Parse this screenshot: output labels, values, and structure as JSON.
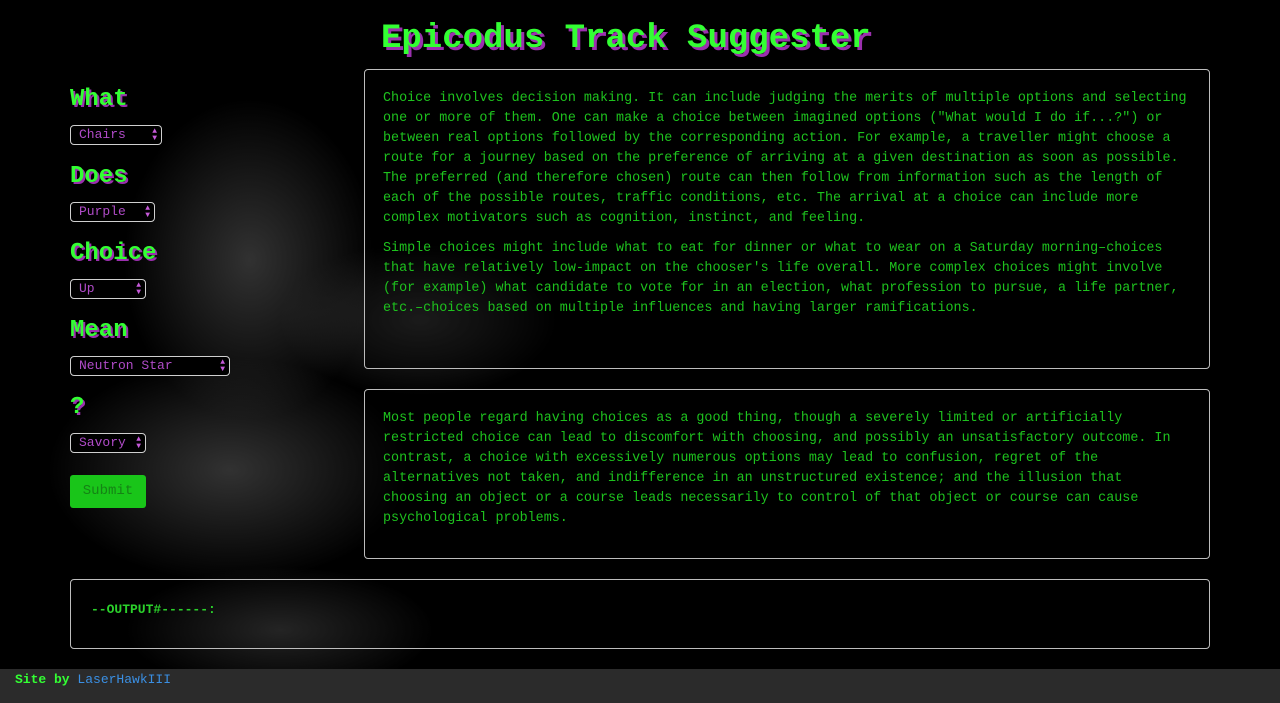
{
  "title": "Epicodus Track Suggester",
  "form": {
    "questions": [
      {
        "label": "What",
        "selected": "Chairs"
      },
      {
        "label": "Does",
        "selected": "Purple"
      },
      {
        "label": "Choice",
        "selected": "Up"
      },
      {
        "label": "Mean",
        "selected": "Neutron Star"
      },
      {
        "label": "?",
        "selected": "Savory"
      }
    ],
    "submit_label": "Submit"
  },
  "panels": {
    "first": {
      "p1": "Choice involves decision making. It can include judging the merits of multiple options and selecting one or more of them. One can make a choice between imagined options (\"What would I do if...?\") or between real options followed by the corresponding action. For example, a traveller might choose a route for a journey based on the preference of arriving at a given destination as soon as possible. The preferred (and therefore chosen) route can then follow from information such as the length of each of the possible routes, traffic conditions, etc. The arrival at a choice can include more complex motivators such as cognition, instinct, and feeling.",
      "p2": "Simple choices might include what to eat for dinner or what to wear on a Saturday morning–choices that have relatively low-impact on the chooser's life overall. More complex choices might involve (for example) what candidate to vote for in an election, what profession to pursue, a life partner, etc.–choices based on multiple influences and having larger ramifications."
    },
    "second": {
      "p1": "Most people regard having choices as a good thing, though a severely limited or artificially restricted choice can lead to discomfort with choosing, and possibly an unsatisfactory outcome. In contrast, a choice with excessively numerous options may lead to confusion, regret of the alternatives not taken, and indifference in an unstructured existence; and the illusion that choosing an object or a course leads necessarily to control of that object or course can cause psychological problems."
    }
  },
  "output_text": "--OUTPUT#------:",
  "footer": {
    "prefix": "Site by",
    "author": "LaserHawkIII"
  },
  "colors": {
    "accent_green": "#33ff33",
    "shadow_purple": "#9b2fae",
    "select_text": "#b04bc8",
    "link": "#3a8fe3"
  }
}
